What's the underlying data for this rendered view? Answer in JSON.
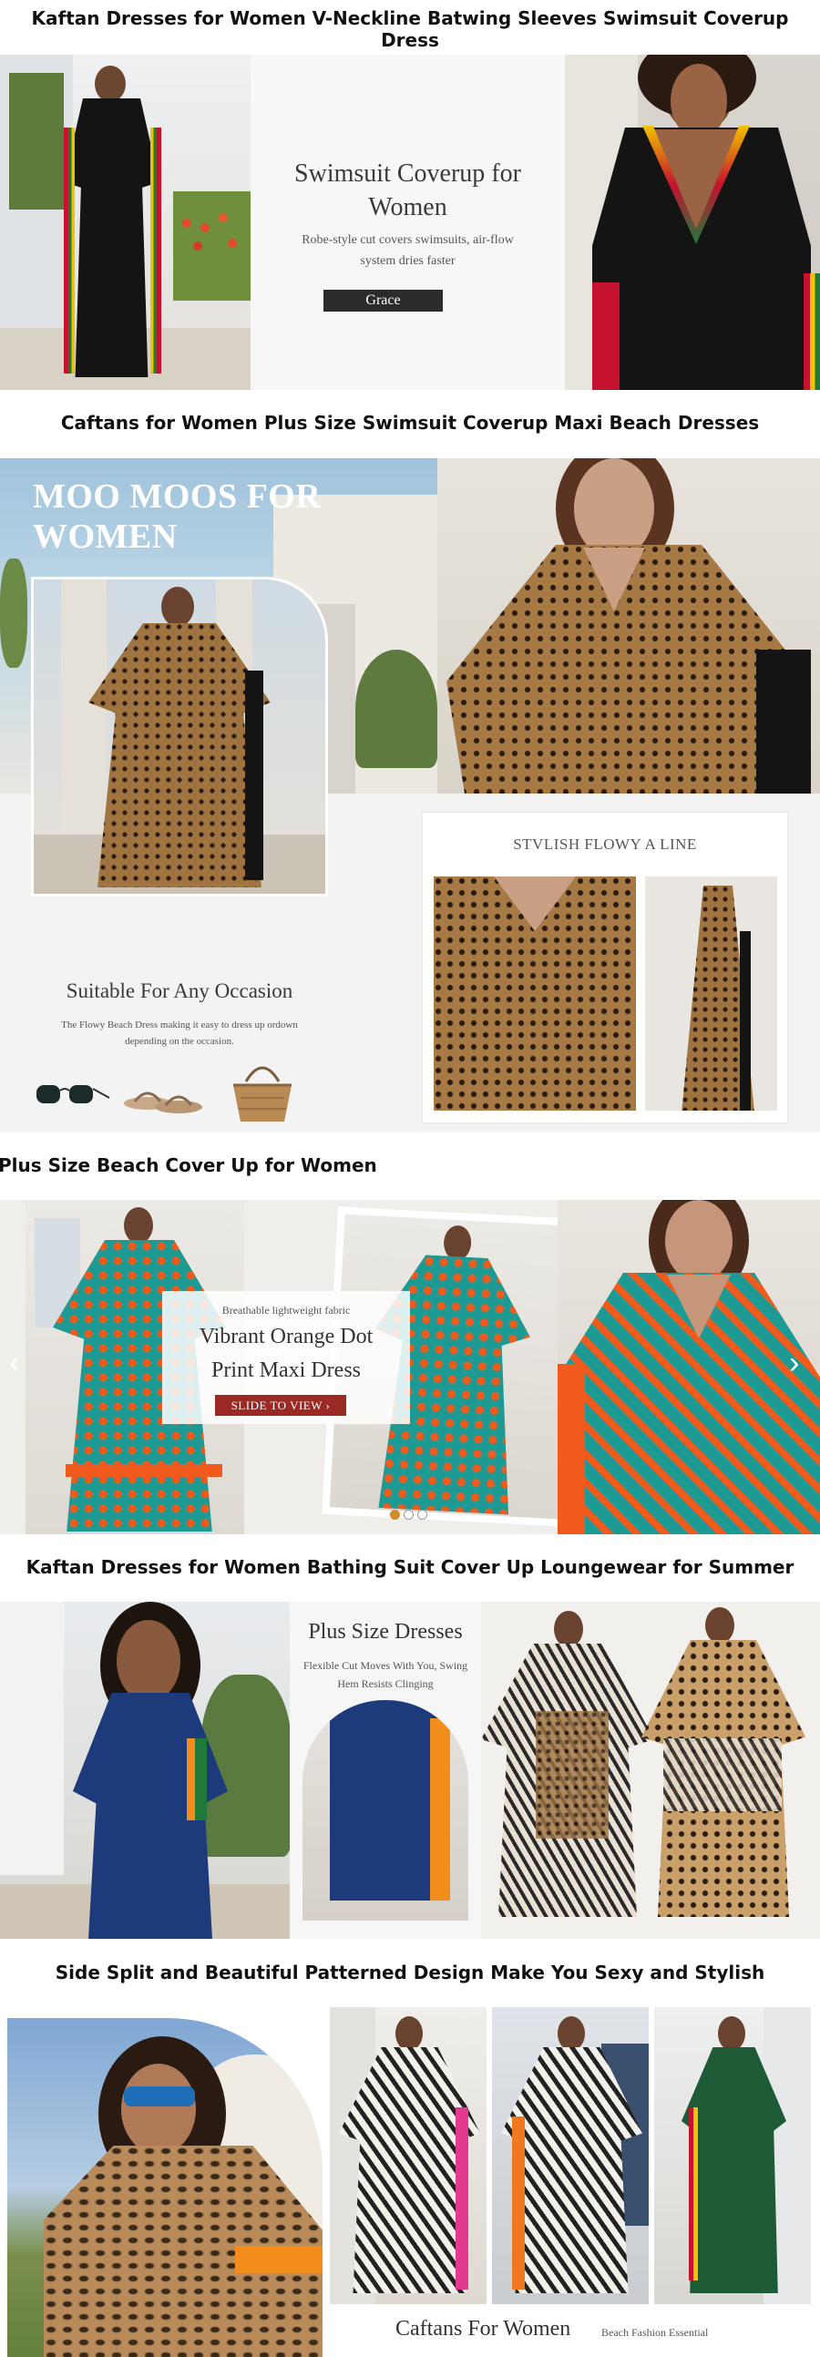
{
  "sections": {
    "s1": {
      "header": "Kaftan Dresses for Women V-Neckline Batwing Sleeves Swimsuit Coverup Dress",
      "title_line1": "Swimsuit Coverup for",
      "title_line2": "Women",
      "desc_line1": "Robe-style cut covers swimsuits, air-flow",
      "desc_line2": "system dries faster",
      "button": "Grace"
    },
    "s2": {
      "header": "Caftans for Women Plus Size Swimsuit Coverup Maxi Beach Dresses",
      "title_line1": "MOO MOOS FOR",
      "title_line2": "WOMEN",
      "occasion_title": "Suitable For Any Occasion",
      "occasion_desc_line1": "The Flowy Beach Dress making it easy to dress up ordown",
      "occasion_desc_line2": "depending on the occasion.",
      "card_title": "STVLISH FLOWY A LINE"
    },
    "s3": {
      "header": "Plus Size Beach Cover Up for Women",
      "kicker": "Breathable lightweight fabric",
      "title_line1": "Vibrant Orange Dot",
      "title_line2": "Print Maxi Dress",
      "button": "SLIDE TO VIEW ›",
      "prev_arrow": "‹",
      "next_arrow": "›",
      "dots_total": 3,
      "active_dot": 1
    },
    "s4": {
      "header": "Kaftan Dresses for Women Bathing Suit Cover Up Loungewear for Summer",
      "title": "Plus Size Dresses",
      "desc_line1": "Flexible Cut Moves With You, Swing",
      "desc_line2": "Hem Resists Clinging"
    },
    "s5": {
      "header": "Side Split and Beautiful Patterned Design Make You Sexy and Stylish",
      "caption": "Caftans For Women",
      "caption_sub": "Beach Fashion Essential"
    }
  },
  "colors": {
    "black_dress": "#141414",
    "accent_red": "#c4122f",
    "stripe_yellow": "#f2c200",
    "stripe_green": "#1f7a3a",
    "leopard": "#8a6233",
    "teal": "#1e9a94",
    "orange": "#f05a1c",
    "navy": "#1d3a7a",
    "button_dark": "#2b2b2b",
    "button_red": "#9b2a24"
  },
  "icons": [
    "sunglasses-icon",
    "sandal-icon",
    "straw-bag-icon",
    "chevron-left-icon",
    "chevron-right-icon"
  ]
}
